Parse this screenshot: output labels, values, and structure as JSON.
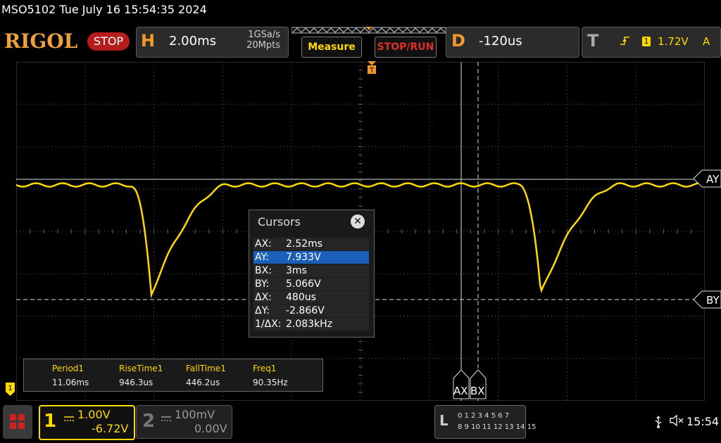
{
  "status_line": "MSO5102  Tue July 16 15:54:35 2024",
  "brand": "RIGOL",
  "run_state": "STOP",
  "horizontal": {
    "letter": "H",
    "timebase": "2.00ms",
    "sample_rate": "1GSa/s",
    "memory_depth": "20Mpts"
  },
  "buttons": {
    "measure": "Measure",
    "stop_run": "STOP/RUN"
  },
  "delay": {
    "letter": "D",
    "value": "-120us"
  },
  "trigger": {
    "letter": "T",
    "source": "1",
    "level": "1.72V",
    "mode": "A",
    "edge_icon": "rising-edge-icon"
  },
  "trigger_marker_label": "T",
  "cursors": {
    "title": "Cursors",
    "close_glyph": "✕",
    "rows": [
      {
        "key": "AX:",
        "value": "2.52ms",
        "selected": false
      },
      {
        "key": "AY:",
        "value": "7.933V",
        "selected": true
      },
      {
        "key": "BX:",
        "value": "3ms",
        "selected": false
      },
      {
        "key": "BY:",
        "value": "5.066V",
        "selected": false
      },
      {
        "key": "ΔX:",
        "value": "480us",
        "selected": false
      },
      {
        "key": "ΔY:",
        "value": "-2.866V",
        "selected": false
      },
      {
        "key": "1/ΔX:",
        "value": "2.083kHz",
        "selected": false
      }
    ],
    "labels": {
      "ax": "AX",
      "bx": "BX",
      "ay": "AY",
      "by": "BY"
    }
  },
  "measurements": [
    {
      "name": "Period1",
      "value": "11.06ms"
    },
    {
      "name": "RiseTime1",
      "value": "946.3us"
    },
    {
      "name": "FallTime1",
      "value": "446.2us"
    },
    {
      "name": "Freq1",
      "value": "90.35Hz"
    }
  ],
  "channel1": {
    "number": "1",
    "scale": "1.00V",
    "offset": "-6.72V",
    "marker": "1",
    "color": "#ffd900"
  },
  "channel2": {
    "number": "2",
    "scale": "100mV",
    "offset": "0.00V"
  },
  "logic_analyzer": {
    "letter": "L",
    "row1": "0 1 2 3   4 5 6 7",
    "row2": "8 9 10 11 12 13 14 15"
  },
  "clock": "15:54",
  "icons": {
    "usb": "usb-icon",
    "speaker": "speaker-muted-icon",
    "menu": "menu-grid-icon"
  },
  "colors": {
    "accent_orange": "#f09a2a",
    "trace_yellow": "#ffd900",
    "stop_red": "#b51c1c",
    "selection_blue": "#1c5fb8"
  }
}
